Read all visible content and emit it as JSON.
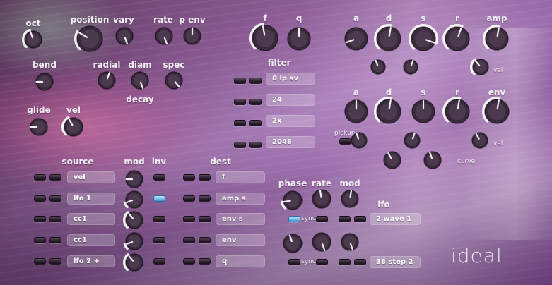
{
  "labels": {
    "oct": "oct",
    "position": "position",
    "vary": "vary",
    "rate": "rate",
    "penv": "p env",
    "bend": "bend",
    "radial": "radial",
    "diam": "diam",
    "spec": "spec",
    "decay": "decay",
    "glide": "glide",
    "vel": "vel",
    "f": "f",
    "q": "q",
    "filter": "filter",
    "amp_a": "a",
    "amp_d": "d",
    "amp_s": "s",
    "amp_r": "r",
    "amp": "amp",
    "amp_vel": "vel",
    "env_a": "a",
    "env_d": "d",
    "env_s": "s",
    "env_r": "r",
    "env": "env",
    "pickup": "pickup",
    "env_vel": "vel",
    "curve": "curve",
    "source": "source",
    "mod": "mod",
    "inv": "inv",
    "dest": "dest",
    "phase": "phase",
    "lfo_rate": "rate",
    "lfo_mod": "mod",
    "lfo": "lfo",
    "sync1": "sync",
    "sync2": "sync"
  },
  "filter_fields": [
    "0  lp sv",
    "24",
    "2x",
    "2048"
  ],
  "mod_matrix": [
    {
      "source": "vel",
      "dest": "f",
      "inv_on": false
    },
    {
      "source": "lfo 1",
      "dest": "amp s",
      "inv_on": true
    },
    {
      "source": "cc1",
      "dest": "env s",
      "inv_on": false
    },
    {
      "source": "cc1",
      "dest": "env",
      "inv_on": false
    },
    {
      "source": "lfo 2 +",
      "dest": "q",
      "inv_on": false
    }
  ],
  "lfo_fields": {
    "wave": "2  wave 1",
    "step": "38 step 2"
  },
  "sync1_on": true,
  "sync2_on": false,
  "logo": "ideal",
  "colors": {
    "accent_on": "#6fb9e8",
    "field_bg": "rgba(255,255,255,0.22)"
  }
}
